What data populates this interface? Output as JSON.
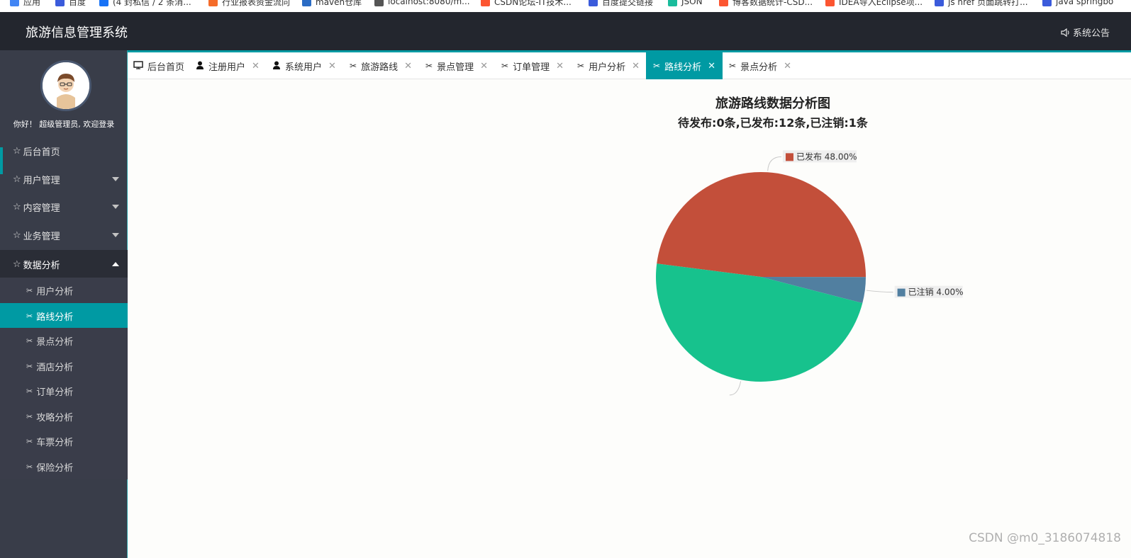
{
  "bookmarks": [
    {
      "label": "应用",
      "color": "#4285f4"
    },
    {
      "label": "百度",
      "color": "#3b5bdb"
    },
    {
      "label": "(4 封私信 / 2 条消...",
      "color": "#1772f6"
    },
    {
      "label": "行业报表资金流向",
      "color": "#f56c2a"
    },
    {
      "label": "maven仓库",
      "color": "#2b6cc4"
    },
    {
      "label": "localhost:8080/m...",
      "color": "#555555"
    },
    {
      "label": "CSDN论坛-IT技术...",
      "color": "#fc5531"
    },
    {
      "label": "百度提交链接",
      "color": "#3b5bdb"
    },
    {
      "label": "JSON",
      "color": "#1abc9c"
    },
    {
      "label": "博客数据统计-CSD...",
      "color": "#fc5531"
    },
    {
      "label": "IDEA导入Eclipse项...",
      "color": "#fc5531"
    },
    {
      "label": "js href 页面跳转打...",
      "color": "#3b5bdb"
    },
    {
      "label": "java springbo",
      "color": "#3b5bdb"
    }
  ],
  "header": {
    "title": "旅游信息管理系统",
    "notice": "系统公告"
  },
  "sidebar": {
    "welcome": "你好！ 超级管理员, 欢迎登录",
    "items": [
      {
        "label": "后台首页"
      },
      {
        "label": "用户管理"
      },
      {
        "label": "内容管理"
      },
      {
        "label": "业务管理"
      },
      {
        "label": "数据分析"
      }
    ],
    "subitems": [
      {
        "label": "用户分析"
      },
      {
        "label": "路线分析"
      },
      {
        "label": "景点分析"
      },
      {
        "label": "酒店分析"
      },
      {
        "label": "订单分析"
      },
      {
        "label": "攻略分析"
      },
      {
        "label": "车票分析"
      },
      {
        "label": "保险分析"
      }
    ]
  },
  "tabs": [
    {
      "label": "后台首页"
    },
    {
      "label": "注册用户"
    },
    {
      "label": "系统用户"
    },
    {
      "label": "旅游路线"
    },
    {
      "label": "景点管理"
    },
    {
      "label": "订单管理"
    },
    {
      "label": "用户分析"
    },
    {
      "label": "路线分析"
    },
    {
      "label": "景点分析"
    }
  ],
  "colors": {
    "accent": "#009aa3",
    "header_bg": "#23262e",
    "sidebar_bg": "#393d49"
  },
  "chart_data": {
    "type": "pie",
    "title": "旅游路线数据分析图",
    "subtitle": "待发布:0条,已发布:12条,已注销:1条",
    "slices": [
      {
        "name": "已发布",
        "value": 48.0,
        "label": "已发布 48.00%",
        "color": "#c34f3a"
      },
      {
        "name": "已注销",
        "value": 4.0,
        "label": "已注销 4.00%",
        "color": "#517fa0"
      },
      {
        "name": "",
        "value": 48.0,
        "label": "",
        "color": "#17c28d"
      }
    ]
  },
  "watermark": "CSDN @m0_3186074818"
}
